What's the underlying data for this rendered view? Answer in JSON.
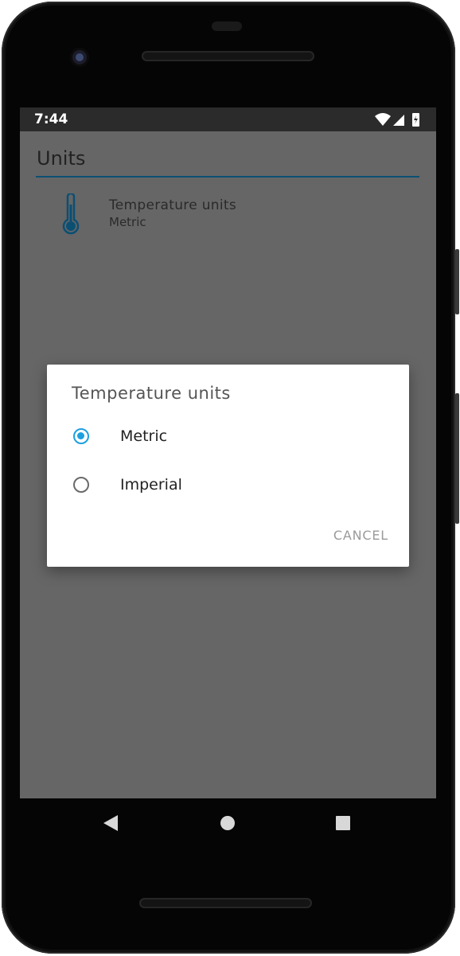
{
  "status_bar": {
    "time": "7:44",
    "icons": [
      "wifi-icon",
      "cell-signal-icon",
      "battery-charging-icon"
    ]
  },
  "app": {
    "title": "Units",
    "accent_color": "#0b4f73"
  },
  "preference": {
    "icon": "thermometer-icon",
    "title": "Temperature units",
    "summary": "Metric"
  },
  "dialog": {
    "title": "Temperature units",
    "options": [
      {
        "label": "Metric",
        "selected": true
      },
      {
        "label": "Imperial",
        "selected": false
      }
    ],
    "cancel_label": "CANCEL",
    "radio_color": "#1ea0e0"
  },
  "nav_bar": {
    "icons": [
      "back-icon",
      "home-icon",
      "recents-icon"
    ]
  }
}
